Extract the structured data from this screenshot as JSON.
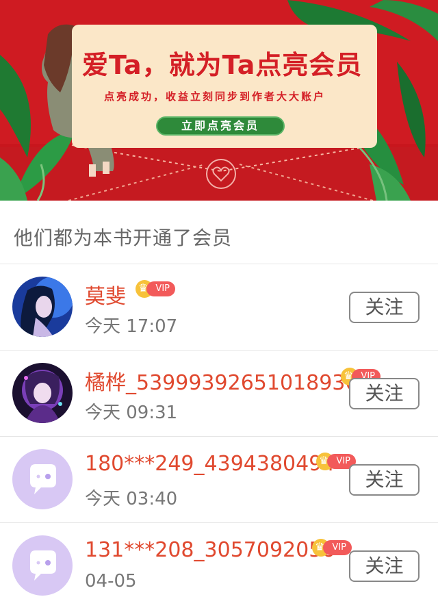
{
  "banner": {
    "headline": "爱Ta，就为Ta点亮会员",
    "subtitle": "点亮成功，收益立刻同步到作者大大账户",
    "cta_label": "立即点亮会员",
    "colors": {
      "background": "#c8161d",
      "card": "#fbe7c8",
      "cta": "#2e8a3a"
    }
  },
  "section_title": "他们都为本书开通了会员",
  "members": [
    {
      "name": "莫斐",
      "time": "今天 17:07",
      "vip": "VIP",
      "follow_label": "关注",
      "avatar": "illustrated-girl-blue"
    },
    {
      "name": "橘桦_53999392651018936",
      "time": "今天 09:31",
      "vip": "VIP",
      "follow_label": "关注",
      "avatar": "illustrated-character-purple"
    },
    {
      "name": "180***249_4394380494",
      "time": "今天 03:40",
      "vip": "VIP",
      "follow_label": "关注",
      "avatar": "default-chat-bubble-icon"
    },
    {
      "name": "131***208_3057092056",
      "time": "04-05",
      "vip": "VIP",
      "follow_label": "关注",
      "avatar": "default-chat-bubble-icon"
    }
  ],
  "colors": {
    "username": "#e0492f",
    "vip_badge": "#f25a5a",
    "crown": "#f7c23a",
    "default_avatar": "#d8c8f4"
  }
}
